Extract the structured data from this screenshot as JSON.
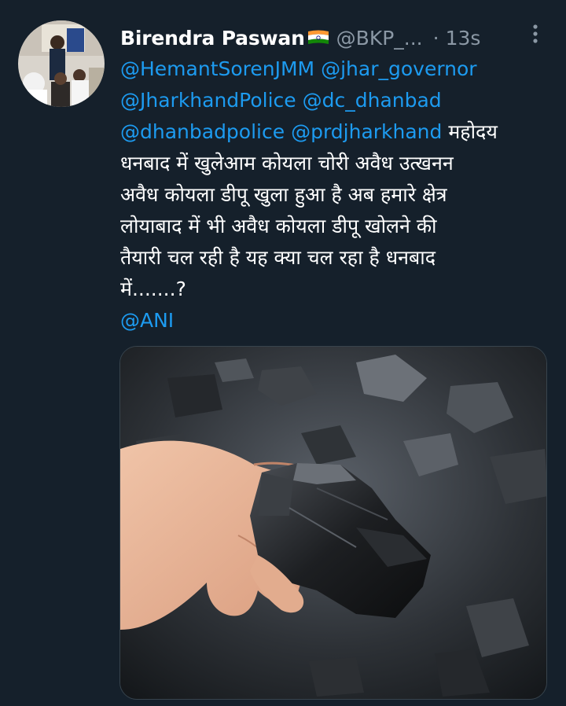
{
  "tweet": {
    "display_name": "Birendra Paswan",
    "flag_icon": "india-flag-icon",
    "handle": "@BKP_...",
    "separator": "·",
    "time": "13s",
    "more_icon": "more-vertical-icon",
    "body": {
      "line1": {
        "m1": "@HemantSorenJMM",
        "m2": "@jhar_governor"
      },
      "line2": {
        "m1": "@JharkhandPolice",
        "m2": "@dc_dhanbad"
      },
      "line3": {
        "m1": "@dhanbadpolice",
        "m2": "@prdjharkhand",
        "text": "महोदय"
      },
      "line4": "धनबाद में खुलेआम कोयला चोरी अवैध उत्खनन",
      "line5": "अवैध कोयला डीपू खुला हुआ है अब हमारे क्षेत्र",
      "line6": "लोयाबाद में भी अवैध कोयला डीपू खोलने की",
      "line7": "तैयारी चल रही है यह क्या चल रहा है धनबाद",
      "line8": "में.......?",
      "line9": "@ANI"
    },
    "colors": {
      "background": "#15202b",
      "link": "#1d9bf0",
      "secondary_text": "#8b98a5"
    }
  }
}
